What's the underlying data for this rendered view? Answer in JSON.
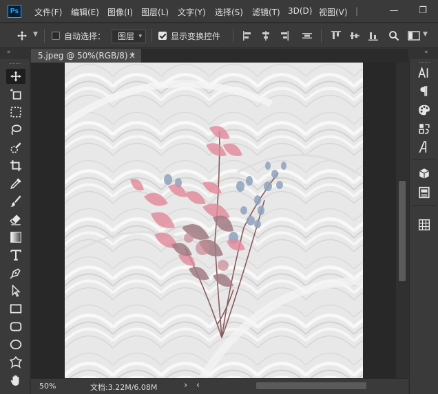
{
  "app": {
    "logo": "Ps"
  },
  "menu": [
    "文件(F)",
    "编辑(E)",
    "图像(I)",
    "图层(L)",
    "文字(Y)",
    "选择(S)",
    "滤镜(T)",
    "3D(D)",
    "视图(V)"
  ],
  "window_controls": {
    "minimize": "—",
    "restore": "❐"
  },
  "options": {
    "auto_select_label": "自动选择：",
    "auto_select_checked": false,
    "auto_select_target": "图层",
    "show_transform_label": "显示变换控件",
    "show_transform_checked": true
  },
  "document": {
    "tab_title": "5.jpeg @ 50%(RGB/8) *",
    "close": "×"
  },
  "status": {
    "zoom": "50%",
    "doc_size": "文档:3.22M/6.08M",
    "arrow_right": "›",
    "arrow_left": "‹"
  },
  "collapse": {
    "left": "»",
    "right": "«"
  },
  "tools": [
    "move-tool",
    "artboard-tool",
    "marquee-tool",
    "lasso-tool",
    "quick-select-tool",
    "crop-tool",
    "eyedropper-tool",
    "brush-tool",
    "eraser-tool",
    "gradient-tool",
    "type-tool",
    "pen-tool",
    "path-select-tool",
    "rectangle-tool",
    "rounded-rectangle-tool",
    "ellipse-tool",
    "custom-shape-tool",
    "hand-tool"
  ],
  "right_panel": [
    "character-icon",
    "paragraph-icon",
    "color-palette-icon",
    "glyph-swap-icon",
    "glyphs-icon",
    "3d-icon",
    "layer-comps-icon",
    "grid-icon"
  ],
  "colors": {
    "ui_bg": "#3a3a3a",
    "canvas_bg": "#282828",
    "accent": "#31a8ff"
  }
}
